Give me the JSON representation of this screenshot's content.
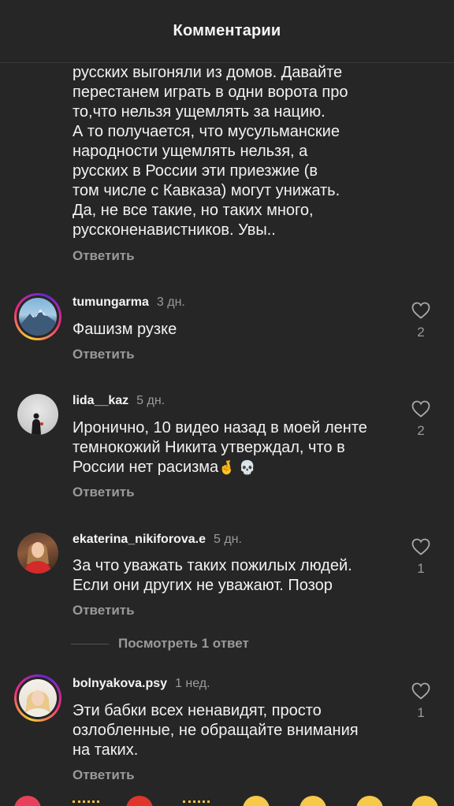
{
  "header": {
    "title": "Комментарии"
  },
  "continuation": {
    "lines": [
      "русских выгоняли из домов. Давайте",
      "перестанем играть в одни ворота про",
      "то,что нельзя ущемлять за нацию.",
      "А то получается, что мусульманские",
      "народности ущемлять нельзя, а",
      "русских в России эти приезжие (в",
      "том числе с Кавказа) могут унижать.",
      "Да, не все такие, но таких много,",
      "руссконенавистников. Увы.."
    ],
    "reply_label": "Ответить"
  },
  "comments": [
    {
      "username": "tumungarma",
      "time": "3 дн.",
      "lines": [
        "Фашизм рузке"
      ],
      "likes": "2",
      "reply_label": "Ответить",
      "avatar": "mountain-photo"
    },
    {
      "username": "lida__kaz",
      "time": "5 дн.",
      "lines": [
        "Иронично, 10 видео назад в моей ленте",
        "темнокожий Никита утверждал, что в",
        "России нет расизма"
      ],
      "emojis": "🤞 💀",
      "likes": "2",
      "reply_label": "Ответить",
      "avatar": "silhouette-photo"
    },
    {
      "username": "ekaterina_nikiforova.e",
      "time": "5 дн.",
      "lines": [
        "За что уважать таких пожилых людей.",
        "Если они других не  уважают.  Позор"
      ],
      "likes": "1",
      "reply_label": "Ответить",
      "view_replies": "Посмотреть 1 ответ",
      "avatar": "woman-red-photo"
    },
    {
      "username": "bolnyakova.psy",
      "time": "1 нед.",
      "lines": [
        "Эти бабки всех ненавидят, просто",
        "озлобленные, не обращайте внимания",
        "на таких."
      ],
      "likes": "1",
      "reply_label": "Ответить",
      "avatar": "blonde-woman-photo"
    }
  ],
  "reaction_bar": [
    "heart-eyes-emoji",
    "clap-emoji",
    "fire-emoji",
    "raised-hands-emoji",
    "crying-laugh-emoji",
    "wow-emoji",
    "laugh-emoji",
    "grin-emoji"
  ]
}
